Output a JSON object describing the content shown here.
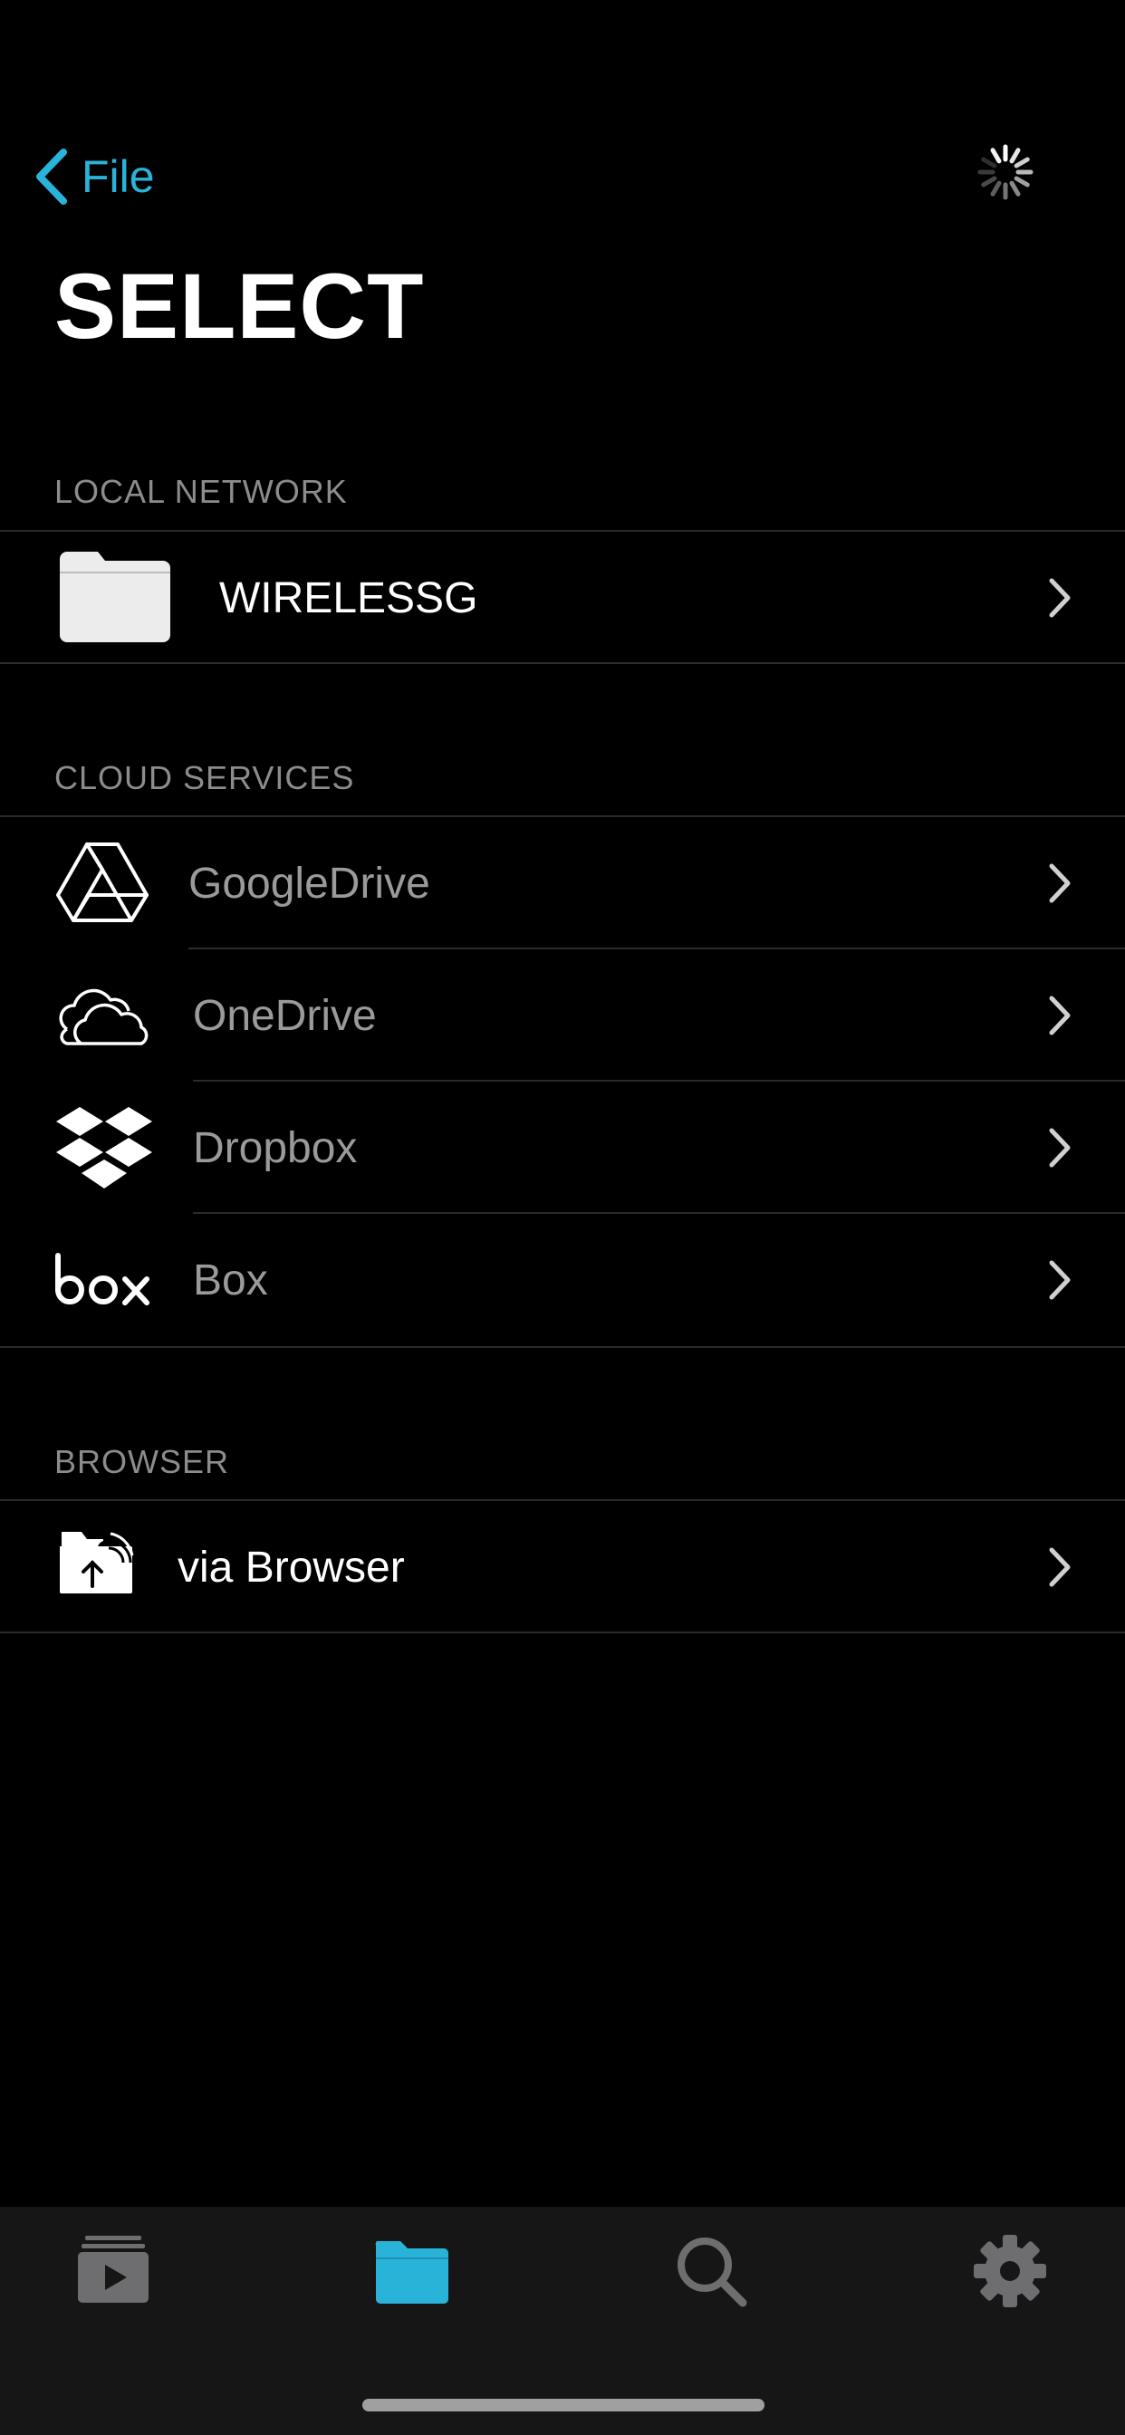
{
  "nav": {
    "back_label": "File",
    "back_icon": "chevron-left-icon",
    "activity_icon": "spinner-icon"
  },
  "title": "SELECT",
  "sections": {
    "local_network": {
      "header": "LOCAL NETWORK",
      "items": [
        {
          "label": "WIRELESSG",
          "icon": "folder-icon"
        }
      ]
    },
    "cloud_services": {
      "header": "CLOUD SERVICES",
      "items": [
        {
          "label": "GoogleDrive",
          "icon": "google-drive-icon"
        },
        {
          "label": "OneDrive",
          "icon": "onedrive-icon"
        },
        {
          "label": "Dropbox",
          "icon": "dropbox-icon"
        },
        {
          "label": "Box",
          "icon": "box-icon"
        }
      ]
    },
    "browser": {
      "header": "BROWSER",
      "items": [
        {
          "label": "via Browser",
          "icon": "folder-upload-wifi-icon"
        }
      ]
    }
  },
  "tabbar": {
    "tabs": [
      {
        "icon": "media-library-icon",
        "selected": false
      },
      {
        "icon": "folder-icon",
        "selected": true
      },
      {
        "icon": "search-icon",
        "selected": false
      },
      {
        "icon": "gear-icon",
        "selected": false
      }
    ]
  },
  "colors": {
    "accent": "#29b3d9",
    "background": "#000000",
    "tabbar_background": "#161616",
    "section_header": "#8c8c8e",
    "cloud_label": "#9a9a9c",
    "tab_inactive": "#6e6e70",
    "separator": "#2a2a2c"
  }
}
